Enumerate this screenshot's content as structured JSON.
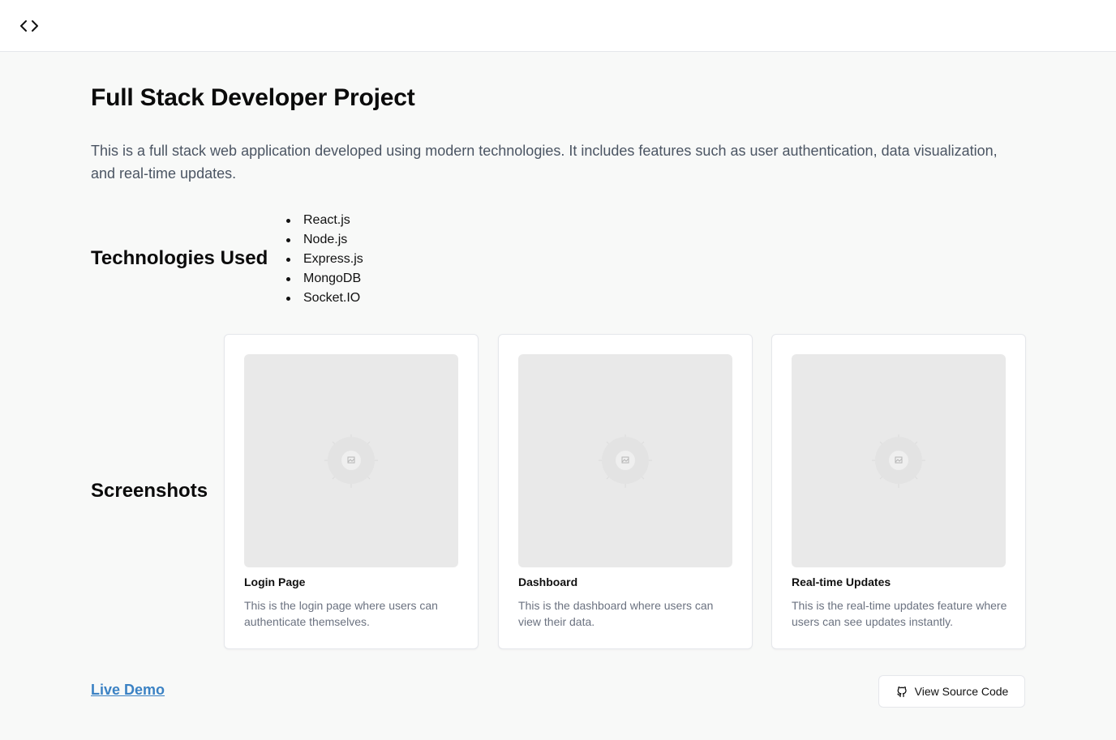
{
  "header": {
    "icon": "code-brackets-icon"
  },
  "project": {
    "title": "Full Stack Developer Project",
    "description": "This is a full stack web application developed using modern technologies. It includes features such as user authentication, data visualization, and real-time updates."
  },
  "technologies": {
    "heading": "Technologies Used",
    "items": [
      "React.js",
      "Node.js",
      "Express.js",
      "MongoDB",
      "Socket.IO"
    ]
  },
  "screenshots": {
    "heading": "Screenshots",
    "cards": [
      {
        "title": "Login Page",
        "description": "This is the login page where users can authenticate themselves.",
        "image_icon": "image-placeholder-icon"
      },
      {
        "title": "Dashboard",
        "description": "This is the dashboard where users can view their data.",
        "image_icon": "image-placeholder-icon"
      },
      {
        "title": "Real-time Updates",
        "description": "This is the real-time updates feature where users can see updates instantly.",
        "image_icon": "image-placeholder-icon"
      }
    ]
  },
  "links": {
    "live_demo": "Live Demo",
    "view_source": "View Source Code",
    "view_source_icon": "github-icon"
  },
  "colors": {
    "link": "#3b82c4",
    "page_bg": "#f8f9f8",
    "placeholder_bg": "#e9e9e9"
  }
}
